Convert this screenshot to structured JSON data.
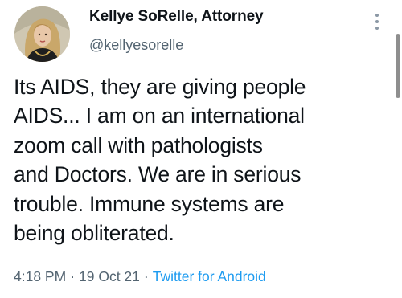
{
  "tweet": {
    "author": {
      "display_name": "Kellye SoRelle, Attorney",
      "handle": "@kellyesorelle"
    },
    "text": "Its AIDS, they are giving people\nAIDS... I am on an international\nzoom call with pathologists\nand Doctors. We are in serious\ntrouble. Immune systems are\nbeing obliterated.",
    "time": "4:18 PM",
    "date": "19 Oct 21",
    "separator": "·",
    "source": "Twitter for Android"
  },
  "colors": {
    "text": "#0f1419",
    "secondary": "#536471",
    "link": "#1d9bf0"
  },
  "icons": {
    "more": "more-vertical-icon"
  }
}
